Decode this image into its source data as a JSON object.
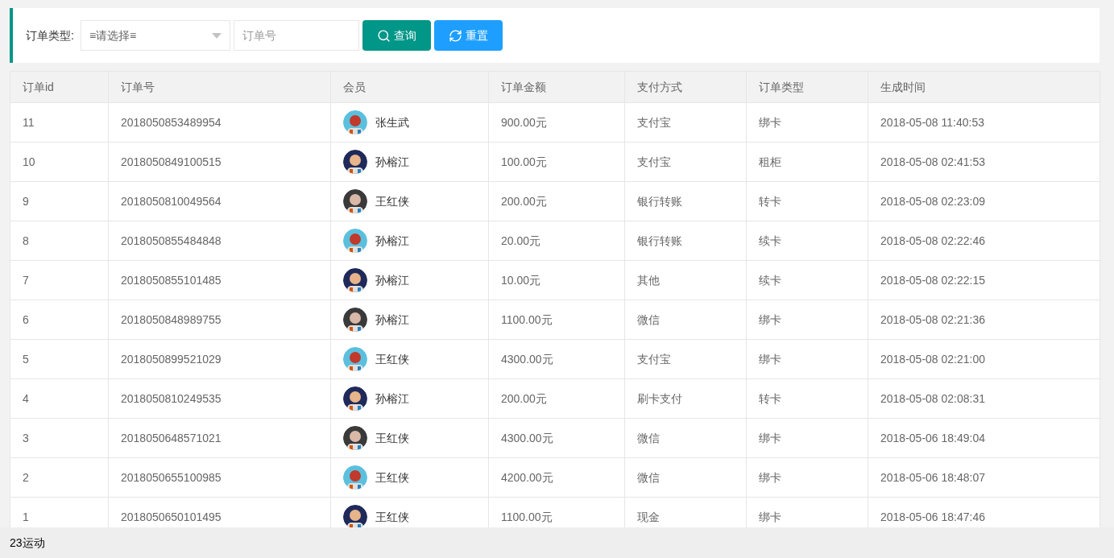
{
  "filter": {
    "label": "订单类型:",
    "select": {
      "value": "≡请选择≡"
    },
    "order_field": {
      "placeholder": "订单号"
    },
    "buttons": [
      {
        "kind": "search",
        "label": "查询"
      },
      {
        "kind": "reset",
        "label": "重置"
      }
    ]
  },
  "table": {
    "columns": [
      "订单id",
      "订单号",
      "会员",
      "订单金额",
      "支付方式",
      "订单类型",
      "生成时间"
    ],
    "rows": [
      {
        "id": "11",
        "order_no": "2018050853489954",
        "member": "张生武",
        "amount": "900.00元",
        "payment": "支付宝",
        "type": "绑卡",
        "time": "2018-05-08 11:40:53"
      },
      {
        "id": "10",
        "order_no": "2018050849100515",
        "member": "孙榕江",
        "amount": "100.00元",
        "payment": "支付宝",
        "type": "租柜",
        "time": "2018-05-08 02:41:53"
      },
      {
        "id": "9",
        "order_no": "2018050810049564",
        "member": "王红侠",
        "amount": "200.00元",
        "payment": "银行转账",
        "type": "转卡",
        "time": "2018-05-08 02:23:09"
      },
      {
        "id": "8",
        "order_no": "2018050855484848",
        "member": "孙榕江",
        "amount": "20.00元",
        "payment": "银行转账",
        "type": "续卡",
        "time": "2018-05-08 02:22:46"
      },
      {
        "id": "7",
        "order_no": "2018050855101485",
        "member": "孙榕江",
        "amount": "10.00元",
        "payment": "其他",
        "type": "续卡",
        "time": "2018-05-08 02:22:15"
      },
      {
        "id": "6",
        "order_no": "2018050848989755",
        "member": "孙榕江",
        "amount": "1100.00元",
        "payment": "微信",
        "type": "绑卡",
        "time": "2018-05-08 02:21:36"
      },
      {
        "id": "5",
        "order_no": "2018050899521029",
        "member": "王红侠",
        "amount": "4300.00元",
        "payment": "支付宝",
        "type": "绑卡",
        "time": "2018-05-08 02:21:00"
      },
      {
        "id": "4",
        "order_no": "2018050810249535",
        "member": "孙榕江",
        "amount": "200.00元",
        "payment": "刷卡支付",
        "type": "转卡",
        "time": "2018-05-08 02:08:31"
      },
      {
        "id": "3",
        "order_no": "2018050648571021",
        "member": "王红侠",
        "amount": "4300.00元",
        "payment": "微信",
        "type": "绑卡",
        "time": "2018-05-06 18:49:04"
      },
      {
        "id": "2",
        "order_no": "2018050655100985",
        "member": "王红侠",
        "amount": "4200.00元",
        "payment": "微信",
        "type": "绑卡",
        "time": "2018-05-06 18:48:07"
      },
      {
        "id": "1",
        "order_no": "2018050650101495",
        "member": "王红侠",
        "amount": "1100.00元",
        "payment": "现金",
        "type": "绑卡",
        "time": "2018-05-06 18:47:46"
      }
    ]
  },
  "footer": {
    "text": "23运动"
  }
}
